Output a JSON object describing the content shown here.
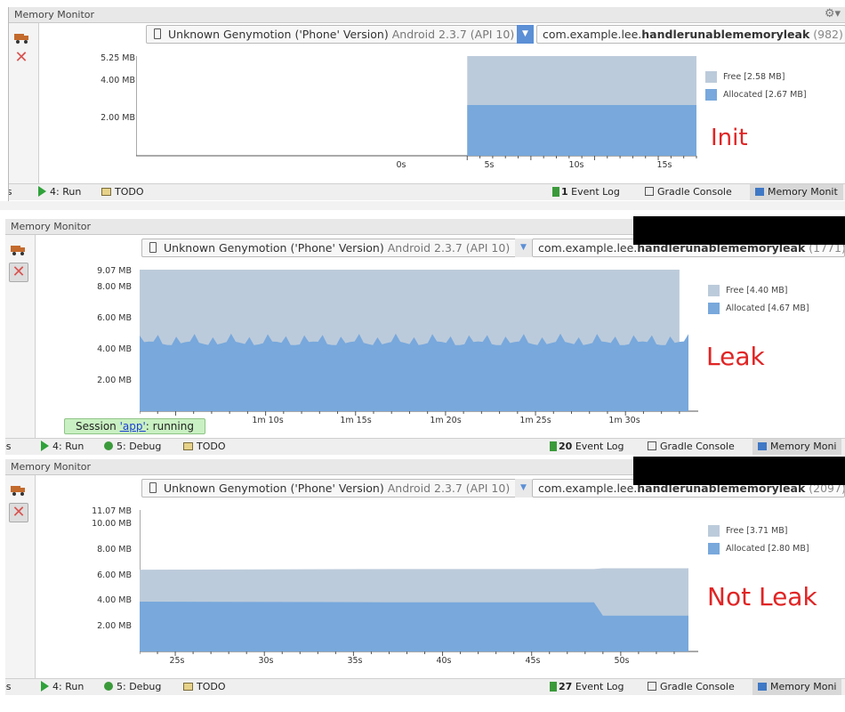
{
  "panels": [
    {
      "title": "Memory Monitor",
      "device": {
        "name": "Unknown Genymotion ('Phone' Version)",
        "api": "Android 2.3.7 (API 10)"
      },
      "process": {
        "prefix": "com.example.lee.",
        "name": "handlerunablememoryleak",
        "pid": "(982)"
      },
      "y_labels": [
        "5.25 MB",
        "4.00 MB",
        "2.00 MB"
      ],
      "x_labels": [
        "0s",
        "5s",
        "10s",
        "15s"
      ],
      "legend": {
        "free": "Free [2.58 MB]",
        "allocated": "Allocated [2.67 MB]"
      },
      "annotation": "Init",
      "toolbar": {
        "left_cut": "es",
        "run": "4: Run",
        "todo": "TODO",
        "event_log_count": "1",
        "event_log": "Event Log",
        "gradle": "Gradle Console",
        "memory": "Memory Monit"
      }
    },
    {
      "title": "Memory Monitor",
      "device": {
        "name": "Unknown Genymotion ('Phone' Version)",
        "api": "Android 2.3.7 (API 10)"
      },
      "process": {
        "prefix": "com.example.lee.",
        "name": "handlerunablememoryleak",
        "pid": "(1771)"
      },
      "y_labels": [
        "9.07 MB",
        "8.00 MB",
        "6.00 MB",
        "4.00 MB",
        "2.00 MB"
      ],
      "x_labels": [
        "1m 10s",
        "1m 15s",
        "1m 20s",
        "1m 25s",
        "1m 30s"
      ],
      "legend": {
        "free": "Free [4.40 MB]",
        "allocated": "Allocated [4.67 MB]"
      },
      "annotation": "Leak",
      "tooltip": {
        "prefix": "Session ",
        "link": "'app'",
        "suffix": ": running"
      },
      "toolbar": {
        "left_cut": "es",
        "run": "4: Run",
        "debug": "5: Debug",
        "todo": "TODO",
        "event_log_count": "20",
        "event_log": "Event Log",
        "gradle": "Gradle Console",
        "memory": "Memory Moni"
      }
    },
    {
      "title": "Memory Monitor",
      "device": {
        "name": "Unknown Genymotion ('Phone' Version)",
        "api": "Android 2.3.7 (API 10)"
      },
      "process": {
        "prefix": "com.example.lee.",
        "name": "handlerunablememoryleak",
        "pid": "(2097)"
      },
      "y_labels": [
        "11.07 MB",
        "10.00 MB",
        "8.00 MB",
        "6.00 MB",
        "4.00 MB",
        "2.00 MB"
      ],
      "x_labels": [
        "25s",
        "30s",
        "35s",
        "40s",
        "45s",
        "50s"
      ],
      "legend": {
        "free": "Free [3.71 MB]",
        "allocated": "Allocated [2.80 MB]"
      },
      "annotation": "Not Leak",
      "toolbar": {
        "left_cut": "es",
        "run": "4: Run",
        "debug": "5: Debug",
        "todo": "TODO",
        "event_log_count": "27",
        "event_log": "Event Log",
        "gradle": "Gradle Console",
        "memory": "Memory Moni"
      }
    }
  ],
  "colors": {
    "free": "#bccbdb",
    "allocated": "#78a8dc",
    "annotation": "#e02424",
    "dropdown": "#5b8fd6"
  },
  "chart_data": [
    {
      "type": "area",
      "x": [
        0,
        0.5,
        18
      ],
      "series": [
        {
          "name": "Allocated",
          "values": [
            0,
            2.67,
            2.67
          ]
        },
        {
          "name": "Free",
          "values": [
            0,
            2.58,
            2.58
          ]
        }
      ],
      "xlabel": "",
      "ylabel": "",
      "ylim": [
        0,
        5.25
      ],
      "xlim": [
        -26,
        18
      ]
    },
    {
      "type": "area",
      "x": [
        63,
        66,
        70,
        74,
        78,
        82,
        86,
        90,
        93
      ],
      "series": [
        {
          "name": "Allocated",
          "values": [
            4.8,
            4.5,
            4.2,
            4.6,
            4.4,
            4.3,
            4.5,
            4.2,
            4.67
          ]
        },
        {
          "name": "Free",
          "values": [
            4.27,
            4.57,
            4.87,
            4.47,
            4.67,
            4.77,
            4.57,
            4.87,
            4.4
          ]
        }
      ],
      "xlabel": "",
      "ylabel": "",
      "ylim": [
        0,
        9.07
      ],
      "xlim": [
        63,
        93.5
      ]
    },
    {
      "type": "area",
      "x": [
        23,
        37,
        48.5,
        49,
        53.8
      ],
      "series": [
        {
          "name": "Allocated",
          "values": [
            3.9,
            3.85,
            3.85,
            2.8,
            2.8
          ]
        },
        {
          "name": "Free",
          "values": [
            2.5,
            2.6,
            2.6,
            3.71,
            3.71
          ]
        }
      ],
      "xlabel": "",
      "ylabel": "",
      "ylim": [
        0,
        11.07
      ],
      "xlim": [
        23,
        53.8
      ]
    }
  ]
}
